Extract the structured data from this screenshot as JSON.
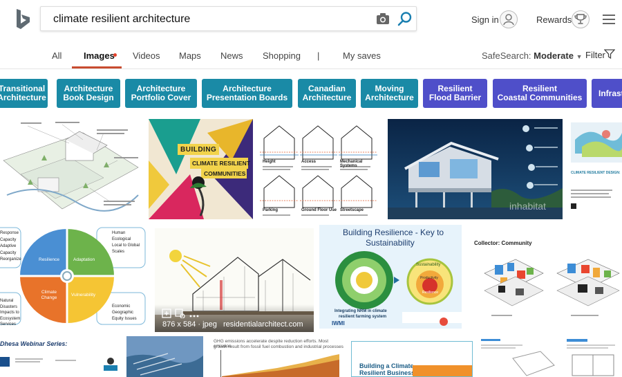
{
  "search": {
    "query": "climate resilient architecture"
  },
  "header": {
    "sign_in": "Sign in",
    "rewards": "Rewards"
  },
  "tabs": [
    "All",
    "Images",
    "Videos",
    "Maps",
    "News",
    "Shopping",
    "|",
    "My saves"
  ],
  "safesearch": {
    "label": "SafeSearch:",
    "value": "Moderate"
  },
  "filter": "Filter",
  "chips": [
    {
      "l1": "Transitional",
      "l2": "Architecture"
    },
    {
      "l1": "Architecture",
      "l2": "Book Design"
    },
    {
      "l1": "Architecture",
      "l2": "Portfolio Cover"
    },
    {
      "l1": "Architecture",
      "l2": "Presentation Boards"
    },
    {
      "l1": "Canadian",
      "l2": "Architecture"
    },
    {
      "l1": "Moving",
      "l2": "Architecture"
    },
    {
      "l1": "Resilient",
      "l2": "Flood Barrier"
    },
    {
      "l1": "Resilient",
      "l2": "Coastal Communities"
    },
    {
      "l1": "Infrast",
      "l2": ""
    }
  ],
  "images": {
    "poster_line1": "BUILDING",
    "poster_line2": "CLIMATE RESILIENT",
    "poster_line3": "COMMUNITIES",
    "house_labels": [
      "Height",
      "Access",
      "Mechanical Systems",
      "Parking",
      "Ground Floor Use",
      "Streetscape"
    ],
    "watermark": "inhabitat",
    "report_title": "CLIMATE RESILIENT DESIGN:",
    "wheel_left": [
      "Response",
      "Capacity",
      "Adaptive",
      "Capacity",
      "Reorganize"
    ],
    "wheel_sectors": [
      "Resilience",
      "Adaptation",
      "Climate Change",
      "Vulnerability"
    ],
    "wheel_right_top": [
      "Human",
      "Ecological",
      "Local to Global",
      "Scales"
    ],
    "wheel_right_bottom": [
      "Economic",
      "Geographic",
      "Equity Issues"
    ],
    "wheel_left_bottom": [
      "Natural",
      "Disasters",
      "Impacts to",
      "Ecosystem",
      "Services"
    ],
    "key_title1": "Building Resilience - Key to",
    "key_title2": "Sustainability",
    "key_caption1": "Integrating NRM in climate",
    "key_caption2": "resilient farming system",
    "key_right": [
      "Sustainability",
      "Productivity",
      "Resilience"
    ],
    "key_logo": "IWMI",
    "collector": "Collector: Community",
    "meta": "876 x 584 · jpeg",
    "meta_source": "residentialarchitect.com",
    "webinar": "Dhesa Webinar Series:",
    "ghg_title": "GHG emissions accelerate despite reduction efforts. Most emission",
    "ghg_title2": "growth result from fossil fuel combustion and industrial processes",
    "building_climate": "Building a Climate",
    "resilient_business": "Resilient Business:"
  },
  "colors": {
    "accent": "#c84b2f",
    "chip_teal": "#1a8aa6",
    "chip_purple": "#4f4fc9"
  }
}
